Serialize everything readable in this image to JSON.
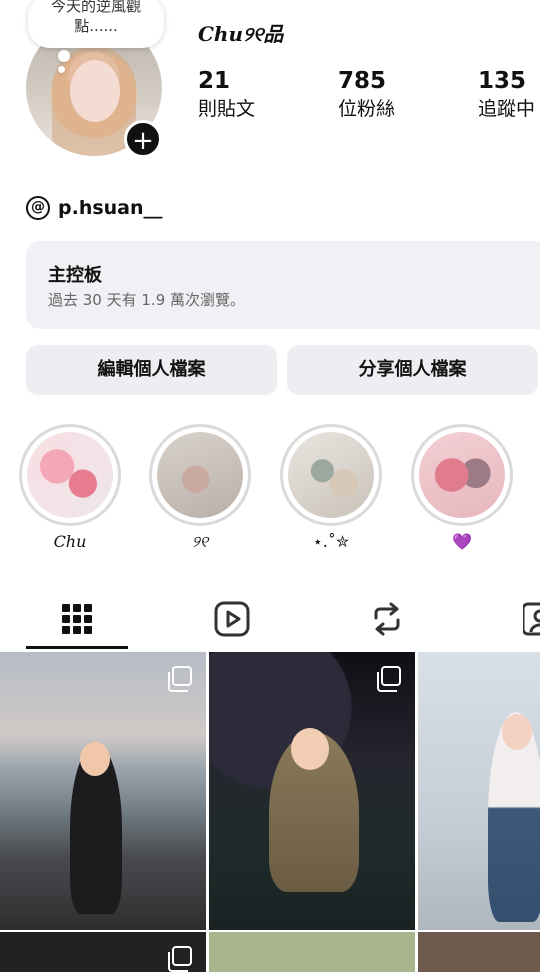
{
  "profile": {
    "note": "今天的逆風觀點......",
    "display_name": "Chu୨୧品",
    "threads_handle": "p.hsuan__"
  },
  "stats": [
    {
      "value": "21",
      "label": "則貼文"
    },
    {
      "value": "785",
      "label": "位粉絲"
    },
    {
      "value": "135",
      "label": "追蹤中"
    }
  ],
  "dashboard": {
    "title": "主控板",
    "subtitle": "過去 30 天有 1.9 萬次瀏覽。"
  },
  "buttons": {
    "edit_profile": "編輯個人檔案",
    "share_profile": "分享個人檔案"
  },
  "highlights": [
    {
      "caption": "Chu"
    },
    {
      "caption": "୨୧"
    },
    {
      "caption": "⋆.˚✮"
    },
    {
      "caption": "💜"
    }
  ],
  "tabs": [
    {
      "icon": "grid-icon",
      "active": true
    },
    {
      "icon": "reels-icon",
      "active": false
    },
    {
      "icon": "reposts-icon",
      "active": false
    },
    {
      "icon": "tagged-icon",
      "active": false
    }
  ],
  "posts": [
    {
      "kind": "carousel"
    },
    {
      "kind": "carousel"
    },
    {
      "kind": "single"
    }
  ],
  "colors": {
    "accent_dark": "#111111",
    "surface": "#f0f1f4",
    "button_bg": "#eeeef2",
    "ring": "#d9d9de"
  }
}
